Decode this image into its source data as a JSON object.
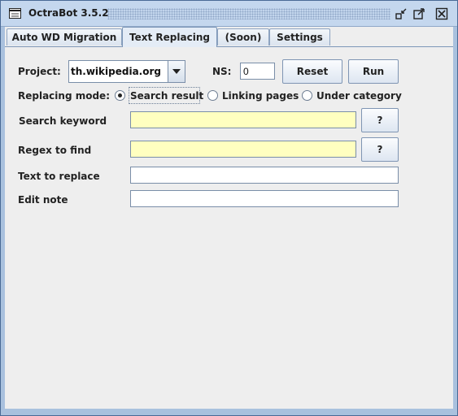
{
  "window": {
    "title": "OctraBot 3.5.2",
    "controls": [
      "minimize-icon",
      "maximize-icon",
      "close-icon"
    ]
  },
  "tabs": [
    {
      "label": "Auto WD Migration",
      "active": false
    },
    {
      "label": "Text Replacing",
      "active": true
    },
    {
      "label": "(Soon)",
      "active": false
    },
    {
      "label": "Settings",
      "active": false
    }
  ],
  "form": {
    "project_label": "Project:",
    "project_value": "th.wikipedia.org",
    "ns_label": "NS:",
    "ns_value": "0",
    "reset_label": "Reset",
    "run_label": "Run",
    "mode_label": "Replacing mode:",
    "modes": [
      {
        "label": "Search result",
        "selected": true
      },
      {
        "label": "Linking pages",
        "selected": false
      },
      {
        "label": "Under category",
        "selected": false
      }
    ],
    "search_keyword_label": "Search keyword",
    "search_keyword_value": "",
    "search_help_label": "?",
    "regex_label": "Regex to find",
    "regex_value": "",
    "regex_help_label": "?",
    "replace_label": "Text to replace",
    "replace_value": "",
    "edit_note_label": "Edit note",
    "edit_note_value": ""
  },
  "colors": {
    "title_bar": "#c4d7ee",
    "window_border": "#a9c1de",
    "panel_bg": "#eeeeee",
    "highlight_field": "#ffffc0"
  }
}
